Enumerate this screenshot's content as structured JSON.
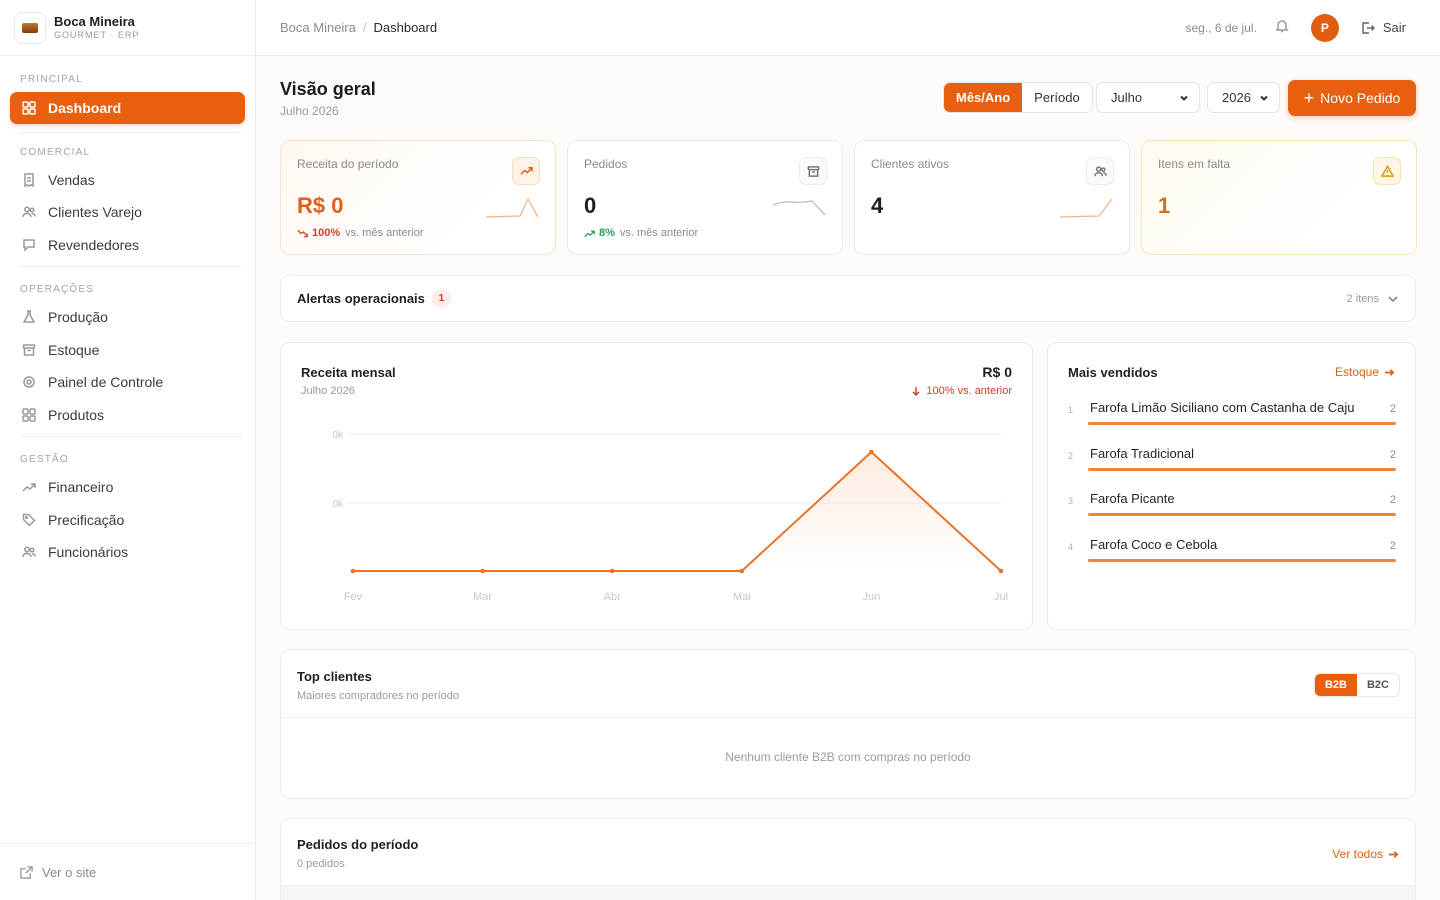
{
  "brand": {
    "name": "Boca Mineira",
    "subtitle": "GOURMET · ERP"
  },
  "sidebar": {
    "sections": [
      {
        "label": "PRINCIPAL",
        "items": [
          {
            "label": "Dashboard",
            "icon": "grid-icon",
            "active": true
          }
        ]
      },
      {
        "label": "COMERCIAL",
        "items": [
          {
            "label": "Vendas",
            "icon": "receipt-icon"
          },
          {
            "label": "Clientes Varejo",
            "icon": "users-icon"
          },
          {
            "label": "Revendedores",
            "icon": "chat-icon"
          }
        ]
      },
      {
        "label": "OPERAÇÕES",
        "items": [
          {
            "label": "Produção",
            "icon": "flask-icon"
          },
          {
            "label": "Estoque",
            "icon": "box-icon"
          },
          {
            "label": "Painel de Controle",
            "icon": "gear-icon"
          },
          {
            "label": "Produtos",
            "icon": "grid-icon"
          }
        ]
      },
      {
        "label": "GESTÃO",
        "items": [
          {
            "label": "Financeiro",
            "icon": "trend-icon"
          },
          {
            "label": "Precificação",
            "icon": "tag-icon"
          },
          {
            "label": "Funcionários",
            "icon": "users-icon"
          }
        ]
      }
    ],
    "footer_link": "Ver o site"
  },
  "topbar": {
    "breadcrumb_root": "Boca Mineira",
    "breadcrumb_sep": "/",
    "breadcrumb_current": "Dashboard",
    "date": "seg., 6 de jul.",
    "avatar_initial": "P",
    "logout_label": "Sair"
  },
  "header": {
    "title": "Visão geral",
    "subtitle": "Julho 2026",
    "mode_tabs": [
      "Mês/Ano",
      "Período"
    ],
    "mode_active": "Mês/Ano",
    "month_select": "Julho",
    "year_select": "2026",
    "new_order_label": "Novo Pedido"
  },
  "kpis": [
    {
      "label": "Receita do período",
      "value": "R$ 0",
      "delta": "100%",
      "delta_suffix": "vs. mês anterior",
      "delta_dir": "down",
      "icon": "trend-up-icon"
    },
    {
      "label": "Pedidos",
      "value": "0",
      "delta": "8%",
      "delta_suffix": "vs. mês anterior",
      "delta_dir": "up",
      "icon": "archive-icon"
    },
    {
      "label": "Clientes ativos",
      "value": "4",
      "icon": "users-icon"
    },
    {
      "label": "Itens em falta",
      "value": "1",
      "icon": "alert-triangle-icon"
    }
  ],
  "alerts": {
    "title": "Alertas operacionais",
    "count": "1",
    "items_label": "2 itens"
  },
  "revenue": {
    "title": "Receita mensal",
    "subtitle": "Julho 2026",
    "total": "R$ 0",
    "delta": "100% vs. anterior"
  },
  "chart_data": {
    "type": "line",
    "title": "Receita mensal",
    "categories": [
      "Fev",
      "Mar",
      "Abr",
      "Mai",
      "Jun",
      "Jul"
    ],
    "values": [
      0,
      0,
      0,
      0,
      1,
      0
    ],
    "y_tick_labels": [
      "0k",
      "0k"
    ],
    "grid": true,
    "color": "#e8742a"
  },
  "best_sellers": {
    "title": "Mais vendidos",
    "link": "Estoque",
    "items": [
      {
        "rank": "1",
        "name": "Farofa Limão Siciliano com Castanha de Caju",
        "qty": "2"
      },
      {
        "rank": "2",
        "name": "Farofa Tradicional",
        "qty": "2"
      },
      {
        "rank": "3",
        "name": "Farofa Picante",
        "qty": "2"
      },
      {
        "rank": "4",
        "name": "Farofa Coco e Cebola",
        "qty": "2"
      }
    ]
  },
  "top_clients": {
    "title": "Top clientes",
    "subtitle": "Maiores compradores no período",
    "tabs": [
      "B2B",
      "B2C"
    ],
    "active_tab": "B2B",
    "empty": "Nenhum cliente B2B com compras no período"
  },
  "orders": {
    "title": "Pedidos do período",
    "subtitle": "0 pedidos",
    "link": "Ver todos"
  },
  "colors": {
    "accent": "#e8600f",
    "accent_line": "#e8742a",
    "danger": "#d23b2b",
    "success": "#2e9a5e"
  }
}
